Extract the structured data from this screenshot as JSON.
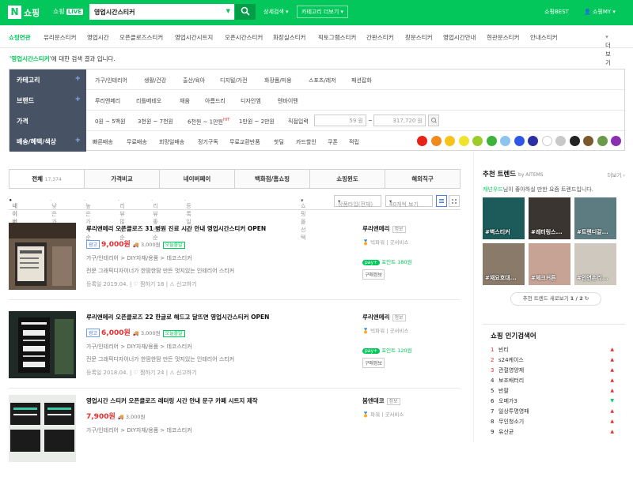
{
  "header": {
    "logo": "N",
    "title": "쇼핑",
    "live_prefix": "쇼핑",
    "live_badge": "LIVE",
    "query": "영업시간스티커",
    "detail_search": "상세검색",
    "category_more": "카테고리 더보기",
    "best": "쇼핑BEST",
    "my": "쇼핑MY"
  },
  "nav": {
    "items": [
      "쇼핑연관",
      "유리문스티커",
      "영업시간",
      "오픈클로즈스티커",
      "영업시간시트지",
      "오픈시간스티커",
      "화장실스티커",
      "픽토그램스티커",
      "간판스티커",
      "창문스티커",
      "영업시간안내",
      "현관문스티커",
      "안내스티커"
    ],
    "more": "더보기"
  },
  "result": {
    "keyword": "'영업시간스티커'",
    "suffix": "에 대한 검색 결과 입니다."
  },
  "filters": {
    "category": {
      "label": "카테고리",
      "options": [
        "가구/인테리어",
        "생활/건강",
        "출산/육아",
        "디지털/가전",
        "화장품/미용",
        "스포츠/레저",
        "패션잡화"
      ]
    },
    "brand": {
      "label": "브랜드",
      "options": [
        "루리앤메리",
        "리틀베테오",
        "채움",
        "아름드리",
        "디자인엠",
        "텐바이텐"
      ]
    },
    "price": {
      "label": "가격",
      "options": [
        "0원 ~ 5백원",
        "3천원 ~ 7천원",
        "6천원 ~ 1만원",
        "1만원 ~ 2만원"
      ],
      "hit": "HIT",
      "direct": "직접입력",
      "min": "59 원",
      "max": "317,720 원",
      "sep": "~"
    },
    "delivery": {
      "label": "배송/혜택/색상",
      "options": [
        "빠른배송",
        "무료배송",
        "희망일배송",
        "정기구독",
        "무료교환반품",
        "핫딜",
        "카드할인",
        "쿠폰",
        "적립"
      ]
    },
    "colors": [
      "#e52317",
      "#f08a1e",
      "#f4c41d",
      "#f0e32b",
      "#9ccc2c",
      "#3fb23a",
      "#8cc4ec",
      "#2e57e6",
      "#2a2fa3",
      "#ffffff",
      "#c8c8c8",
      "#222222",
      "#7a5a2c",
      "#6b9a4b",
      "#8a2fb0"
    ]
  },
  "tabs": [
    {
      "label": "전체",
      "count": "17,374"
    },
    {
      "label": "가격비교"
    },
    {
      "label": "네이버페이"
    },
    {
      "label": "백화점/홈쇼핑"
    },
    {
      "label": "쇼핑윈도"
    },
    {
      "label": "해외직구"
    }
  ],
  "sort": {
    "options": [
      "네이버 랭킹순",
      "낮은 가격순",
      "높은 가격순",
      "리뷰 많은순",
      "리뷰 좋은순",
      "등록일순"
    ],
    "view_select": "쇼핑몰선택",
    "product_type": "상품타입(전체)",
    "page_size": "40개씩 보기"
  },
  "products": [
    {
      "title": "루리앤메리 오픈클로즈 31 병원 진료 시간 안내 영업시간스티커 OPEN",
      "ad": "광고",
      "price": "9,000원",
      "ship": "3,000원",
      "badge": "오늘출발",
      "cat": "가구/인테리어 > DIY자재/용품 > 데코스티커",
      "desc": "전문 그래픽디자이너가 한땀한땀 만든 멋지있는 인테리어 스티커",
      "date": "등록일 2019.04.",
      "like": "찜하기 18",
      "report": "신고하기",
      "shop": "루리앤메리",
      "info": "정보",
      "grade": "빅파워",
      "svc": "굿서비스",
      "pay": "pay+",
      "point": "포인트 180원",
      "buyinfo": "구매정보"
    },
    {
      "title": "루리앤메리 오픈클로즈 22 한글로 해드고 달뜨면 영업시간스티커 OPEN",
      "ad": "광고",
      "price": "6,000원",
      "ship": "3,000원",
      "badge": "오늘출발",
      "cat": "가구/인테리어 > DIY자재/용품 > 데코스티커",
      "desc": "전문 그래픽디자이너가 한땀한땀 만든 멋지있는 인테리어 스티커",
      "date": "등록일 2018.04.",
      "like": "찜하기 24",
      "report": "신고하기",
      "shop": "루리앤메리",
      "info": "정보",
      "grade": "빅파워",
      "svc": "굿서비스",
      "pay": "pay+",
      "point": "포인트 120원",
      "buyinfo": "구매정보"
    },
    {
      "title": "영업시간 스티커 오픈클로즈 레터링 시간 안내 문구 카페 시트지 제작",
      "price": "7,900원",
      "ship": "3,000원",
      "cat": "가구/인테리어 > DIY자재/용품 > 데코스티커",
      "shop": "봄엔데코",
      "info": "정보",
      "grade": "파워",
      "svc": "굿서비스"
    }
  ],
  "side": {
    "title": "추천 트렌드",
    "by": "by AITEMS",
    "more": "더보기",
    "sub_kw": "캐넌우드",
    "sub_text": "님이 좋아하실 만한 요즘 트렌드입니다.",
    "cards": [
      "#벽스티커",
      "#레터링스...",
      "#트렌디갈...",
      "#재요호대...",
      "#체크커튼",
      "#인연손리..."
    ],
    "next": "추천 트렌드 새로보기",
    "page": "1 / 2"
  },
  "popular": {
    "title": "쇼핑 인기검색어",
    "items": [
      "빈티",
      "s24케이스",
      "관절영양제",
      "보조배터리",
      "반팔",
      "오메가3",
      "일상투명영패",
      "무인청소기",
      "유산균"
    ]
  }
}
